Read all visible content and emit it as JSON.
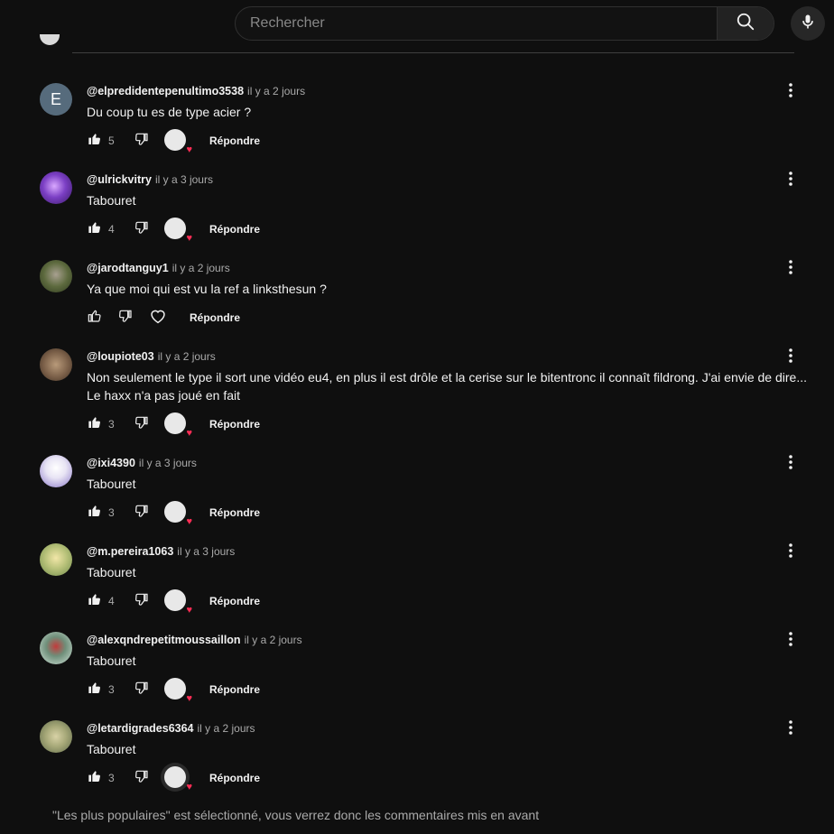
{
  "search": {
    "placeholder": "Rechercher"
  },
  "reply_label": "Répondre",
  "comments": [
    {
      "author": "@elpredidentepenultimo3538",
      "time": "il y a 2 jours",
      "text": "Du coup tu es de type acier ?",
      "likes": "5",
      "hearted": true,
      "avatar_letter": "E"
    },
    {
      "author": "@ulrickvitry",
      "time": "il y a 3 jours",
      "text": "Tabouret",
      "likes": "4",
      "hearted": true
    },
    {
      "author": "@jarodtanguy1",
      "time": "il y a 2 jours",
      "text": "Ya que moi qui est vu la ref a linksthesun ?",
      "likes": "",
      "hearted": false
    },
    {
      "author": "@loupiote03",
      "time": "il y a 2 jours",
      "text_line1": "Non seulement le type il sort une vidéo eu4, en plus il est drôle et la cerise sur le bitentronc il connaît fildrong. J'ai envie de dire...",
      "text_line2": "Le haxx n'a pas joué en fait",
      "likes": "3",
      "hearted": true
    },
    {
      "author": "@ixi4390",
      "time": "il y a 3 jours",
      "text": "Tabouret",
      "likes": "3",
      "hearted": true
    },
    {
      "author": "@m.pereira1063",
      "time": "il y a 3 jours",
      "text": "Tabouret",
      "likes": "4",
      "hearted": true
    },
    {
      "author": "@alexqndrepetitmoussaillon",
      "time": "il y a 2 jours",
      "text": "Tabouret",
      "likes": "3",
      "hearted": true
    },
    {
      "author": "@letardigrades6364",
      "time": "il y a 2 jours",
      "text": "Tabouret",
      "likes": "3",
      "hearted": true
    }
  ],
  "footer_note": "\"Les plus populaires\" est sélectionné, vous verrez donc les commentaires mis en avant",
  "colors": {
    "background": "#0f0f0f",
    "heart": "#ff2d55",
    "muted_text": "#aaaaaa"
  }
}
